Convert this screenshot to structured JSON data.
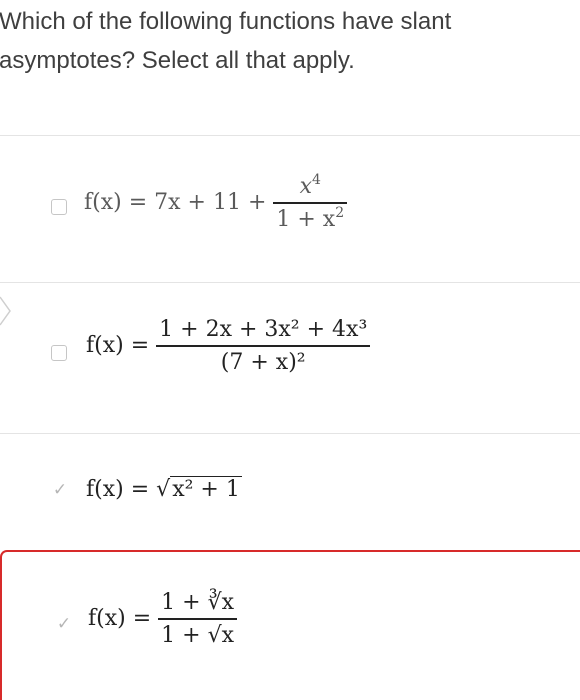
{
  "question": {
    "text": "Which of the following functions have slant asymptotes? Select all that apply."
  },
  "options": [
    {
      "state": "unchecked",
      "lhs": "f(x) = 7x + 11 +",
      "frac_num": "x",
      "frac_num_exp": "4",
      "frac_den": "1 + x",
      "frac_den_exp": "2"
    },
    {
      "state": "unchecked",
      "lhs": "f(x) =",
      "frac_num": "1 + 2x + 3x² + 4x³",
      "frac_den": "(7 + x)²"
    },
    {
      "state": "checked",
      "lhs": "f(x) =",
      "radicand": "x² + 1"
    },
    {
      "state": "checked",
      "status": "incorrect",
      "lhs": "f(x) =",
      "frac_num": "1 + ∛x",
      "frac_den": "1 + √x"
    }
  ],
  "colors": {
    "error_border": "#d72a2a",
    "divider": "#e4e4e4",
    "checkbox_border": "#c6c6c6"
  },
  "icons": {
    "check": "checkmark-icon",
    "box": "checkbox-icon"
  }
}
